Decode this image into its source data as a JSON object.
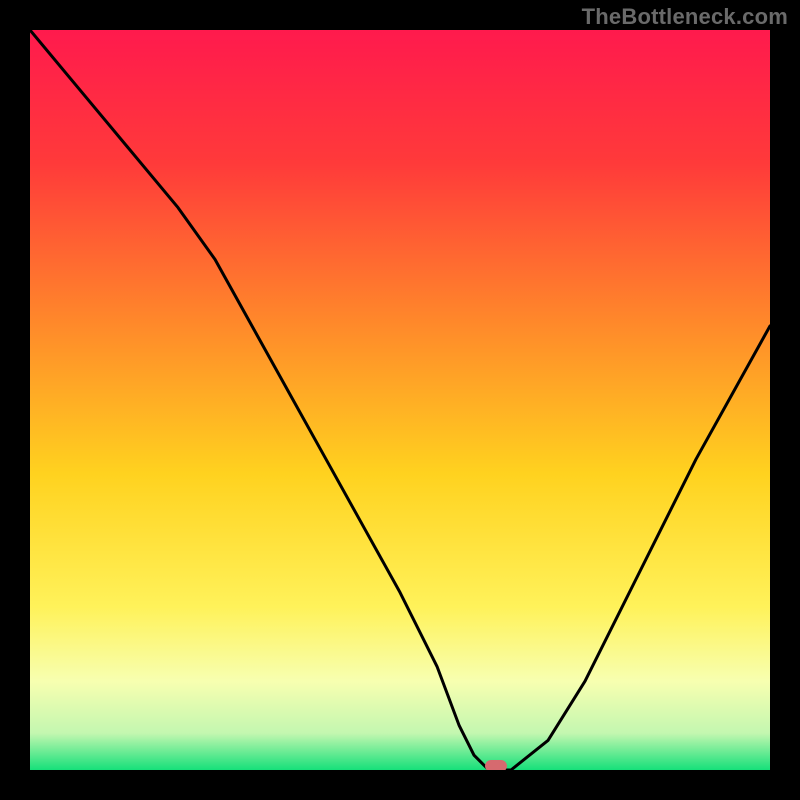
{
  "watermark": "TheBottleneck.com",
  "chart_data": {
    "type": "line",
    "title": "",
    "xlabel": "",
    "ylabel": "",
    "xlim": [
      0,
      100
    ],
    "ylim": [
      0,
      100
    ],
    "x": [
      0,
      5,
      10,
      15,
      20,
      25,
      30,
      35,
      40,
      45,
      50,
      55,
      58,
      60,
      62,
      65,
      70,
      75,
      80,
      85,
      90,
      95,
      100
    ],
    "values": [
      100,
      94,
      88,
      82,
      76,
      69,
      60,
      51,
      42,
      33,
      24,
      14,
      6,
      2,
      0,
      0,
      4,
      12,
      22,
      32,
      42,
      51,
      60
    ],
    "gradient_stops": [
      {
        "pos": 0.0,
        "color": "#ff1a4d"
      },
      {
        "pos": 0.18,
        "color": "#ff3a3a"
      },
      {
        "pos": 0.4,
        "color": "#ff8a2a"
      },
      {
        "pos": 0.6,
        "color": "#ffd21f"
      },
      {
        "pos": 0.78,
        "color": "#fff25a"
      },
      {
        "pos": 0.88,
        "color": "#f7ffb0"
      },
      {
        "pos": 0.95,
        "color": "#c4f7b0"
      },
      {
        "pos": 1.0,
        "color": "#16e07a"
      }
    ],
    "marker": {
      "x": 63,
      "y": 0,
      "color": "#d66a6f"
    }
  }
}
